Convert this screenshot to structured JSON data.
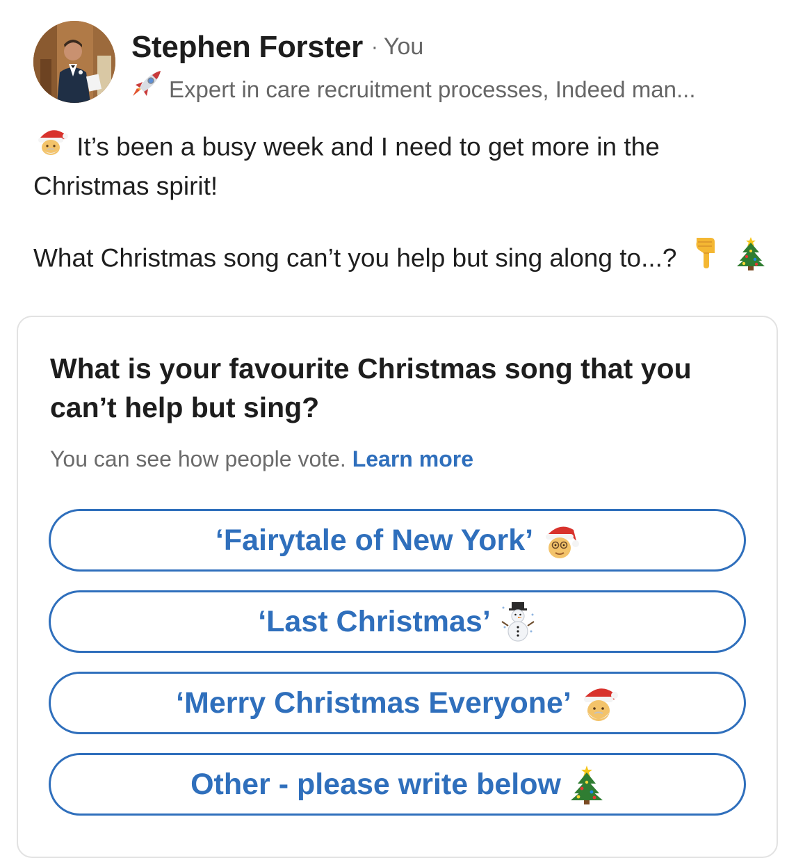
{
  "author": {
    "name": "Stephen Forster",
    "separator": "·",
    "relation": "You",
    "headline": "Expert in care recruitment processes, Indeed man...",
    "headline_icon": "rocket-icon",
    "avatar": "profile-photo"
  },
  "post": {
    "line1": "It’s been a busy week and I need to get more in the Christmas spirit!",
    "line1_icon": "santa-icon",
    "line2": "What Christmas song can’t you help but sing along to...?",
    "line2_icons": [
      "pointing-down-hand-icon",
      "christmas-tree-icon"
    ]
  },
  "poll": {
    "question": "What is your favourite Christmas song that you can’t help but sing?",
    "note": "You can see how people vote.",
    "learn_more": "Learn more",
    "options": [
      {
        "label": "‘Fairytale of New York’",
        "icon": "santa-icon"
      },
      {
        "label": "‘Last Christmas’",
        "icon": "snowman-icon"
      },
      {
        "label": "‘Merry Christmas Everyone’",
        "icon": "santa-icon"
      },
      {
        "label": "Other - please write below",
        "icon": "christmas-tree-icon"
      }
    ]
  },
  "colors": {
    "accent": "#2f6fbc",
    "text": "#1f1f1f",
    "muted": "#666666",
    "border": "#e2e2e2"
  }
}
